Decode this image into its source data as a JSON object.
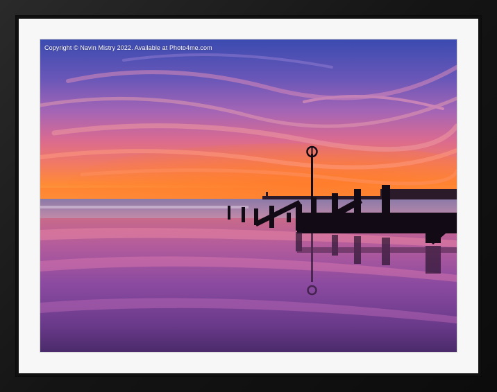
{
  "photo": {
    "copyright_text": "Copyright © Navin Mistry 2022. Available at Photo4me.com"
  },
  "colors": {
    "frame": "#141414",
    "mount": "#f7f7f7",
    "sky_top": "#3a4aa8",
    "horizon": "#ff7a2a",
    "sand_reflection": "#b05a9a"
  }
}
